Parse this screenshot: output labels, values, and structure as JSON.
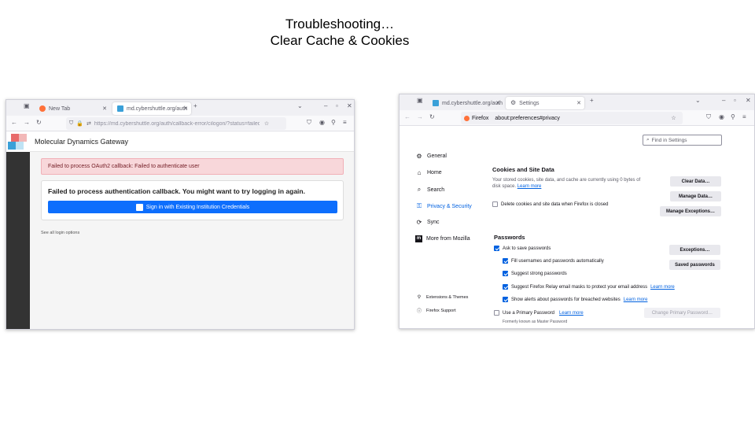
{
  "slide": {
    "title_line1": "Troubleshooting…",
    "title_line2": "Clear Cache & Cookies"
  },
  "left_window": {
    "tabs": [
      {
        "label": "New Tab",
        "active": false
      },
      {
        "label": "md.cybershuttle.org/auth",
        "active": true
      }
    ],
    "url": "https://md.cybershuttle.org/auth/callback-error/cilogon/?status=failed",
    "site_title": "Molecular Dynamics Gateway",
    "alert_text": "Failed to process OAuth2 callback: Failed to authenticate user",
    "card_title": "Failed to process authentication callback. You might want to try logging in again.",
    "signin_label": "Sign in with Existing Institution Credentials",
    "see_prefix": "See",
    "see_link": "all login options"
  },
  "right_window": {
    "tabs": [
      {
        "label": "md.cybershuttle.org/auth",
        "active": false
      },
      {
        "label": "Settings",
        "active": true
      }
    ],
    "identity_label": "Firefox",
    "url": "about:preferences#privacy",
    "find_placeholder": "Find in Settings",
    "categories": [
      {
        "label": "General",
        "icon": "gear-icon"
      },
      {
        "label": "Home",
        "icon": "home-icon"
      },
      {
        "label": "Search",
        "icon": "search-icon"
      },
      {
        "label": "Privacy & Security",
        "icon": "lock-icon"
      },
      {
        "label": "Sync",
        "icon": "sync-icon"
      },
      {
        "label": "More from Mozilla",
        "icon": "mozilla-icon"
      }
    ],
    "footer_links": [
      {
        "label": "Extensions & Themes",
        "icon": "puzzle-icon"
      },
      {
        "label": "Firefox Support",
        "icon": "help-icon"
      }
    ],
    "cookies": {
      "heading": "Cookies and Site Data",
      "desc_line1": "Your stored cookies, site data, and cache are currently using 0 bytes of",
      "desc_line2": "disk space.",
      "learn_more": "Learn more",
      "delete_on_close": "Delete cookies and site data when Firefox is closed",
      "clear_btn": "Clear Data…",
      "manage_btn": "Manage Data…",
      "exceptions_btn": "Manage Exceptions…"
    },
    "passwords": {
      "heading": "Passwords",
      "ask_save": "Ask to save passwords",
      "fill_auto": "Fill usernames and passwords automatically",
      "suggest_strong": "Suggest strong passwords",
      "relay": "Suggest Firefox Relay email masks to protect your email address",
      "breach": "Show alerts about passwords for breached websites",
      "primary": "Use a Primary Password",
      "primary_sub": "Formerly known as Master Password",
      "learn_more": "Learn more",
      "exceptions_btn": "Exceptions…",
      "saved_btn": "Saved passwords",
      "change_primary_btn": "Change Primary Password…"
    }
  }
}
